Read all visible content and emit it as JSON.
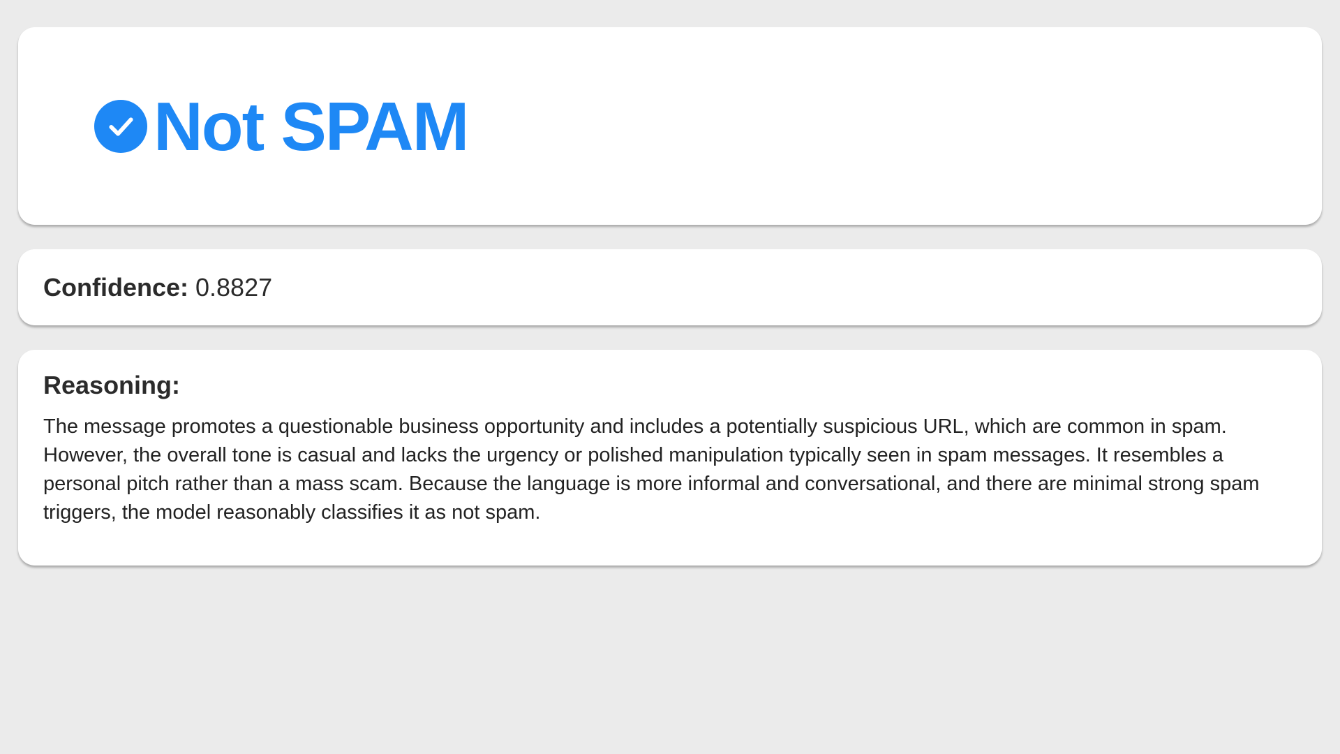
{
  "verdict": {
    "label": "Not SPAM",
    "icon": "check-circle-icon",
    "color": "#1e88f5"
  },
  "confidence": {
    "label": "Confidence:",
    "value": "0.8827"
  },
  "reasoning": {
    "label": "Reasoning:",
    "text": "The message promotes a questionable business opportunity and includes a potentially suspicious URL, which are common in spam. However, the overall tone is casual and lacks the urgency or polished manipulation typically seen in spam messages. It resembles a personal pitch rather than a mass scam. Because the language is more informal and conversational, and there are minimal strong spam triggers, the model reasonably classifies it as not spam."
  },
  "colors": {
    "background": "#ebebeb",
    "card": "#ffffff",
    "accent": "#1e88f5",
    "text": "#2b2b2b"
  }
}
